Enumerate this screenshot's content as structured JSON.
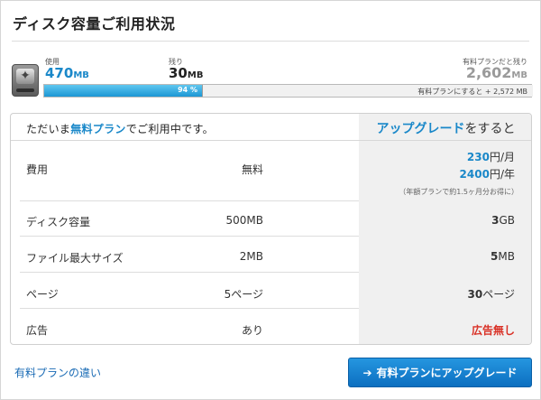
{
  "title": "ディスク容量ご利用状況",
  "usage": {
    "used_label": "使用",
    "used_value": "470",
    "used_unit": "MB",
    "remaining_label": "残り",
    "remaining_value": "30",
    "remaining_unit": "MB",
    "paid_remaining_label": "有料プランだと残り",
    "paid_remaining_value": "2,602",
    "paid_remaining_unit": "MB",
    "percent_used": 94,
    "percent_label": "94 %",
    "paid_note": "有料プランにすると + 2,572 MB"
  },
  "comparison": {
    "current_pre": "ただいま",
    "current_plan": "無料プラン",
    "current_post": "でご利用中です。",
    "upgrade_pre": "アップグレード",
    "upgrade_post": "をすると",
    "rows": [
      {
        "name": "費用",
        "free": "無料"
      },
      {
        "name": "ディスク容量",
        "free": "500MB",
        "paid_num": "3",
        "paid_unit": "GB"
      },
      {
        "name": "ファイル最大サイズ",
        "free": "2MB",
        "paid_num": "5",
        "paid_unit": "MB"
      },
      {
        "name": "ページ",
        "free": "5ページ",
        "paid_num": "30",
        "paid_unit": "ページ"
      },
      {
        "name": "広告",
        "free": "あり",
        "paid_text": "広告無し"
      }
    ],
    "cost_month_num": "230",
    "cost_month_unit": "円/月",
    "cost_year_num": "2400",
    "cost_year_unit": "円/年",
    "cost_note": "（年額プランで約1.5ヶ月分お得に）"
  },
  "footer": {
    "diff_link": "有料プランの違い",
    "upgrade_button": "有料プランにアップグレード"
  },
  "colors": {
    "accent": "#1a88c9",
    "button": "#1776c8",
    "no_ads": "#d93025"
  },
  "icons": {
    "disk": "hard-drive-icon",
    "button_arrow": "arrow-right-icon"
  }
}
